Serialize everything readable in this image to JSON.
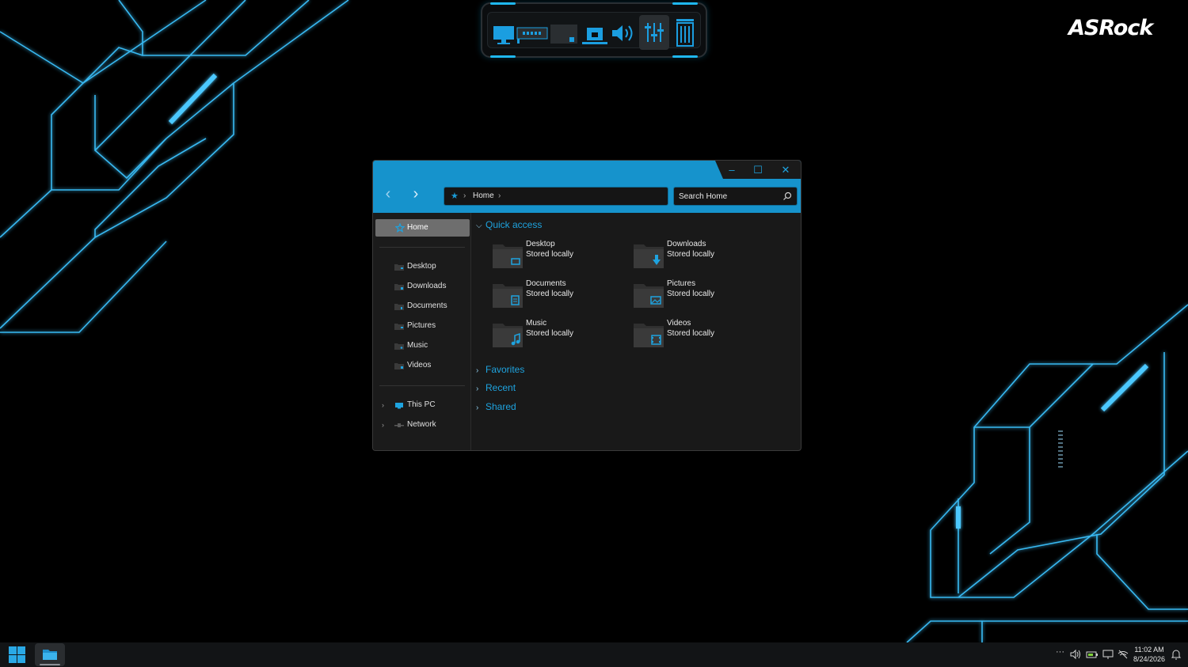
{
  "desktop": {
    "brand_logo": "ASRock",
    "accent_color": "#1ea3df",
    "wallpaper_theme": "black with cyan circuit lines"
  },
  "dock": {
    "items": [
      "monitor-icon",
      "graphics-card-icon",
      "drive-icon",
      "network-icon",
      "speaker-icon",
      "equalizer-icon",
      "recycle-bin-icon"
    ]
  },
  "window": {
    "address": {
      "root_icon": "star-icon",
      "crumb": "Home",
      "separator": "›"
    },
    "search_placeholder": "Search Home",
    "controls": {
      "minimize": "–",
      "maximize": "☐",
      "close": "✕"
    },
    "nav": {
      "back": "‹",
      "forward": "›"
    },
    "sidebar": {
      "home": "Home",
      "libraries": [
        "Desktop",
        "Downloads",
        "Documents",
        "Pictures",
        "Music",
        "Videos"
      ],
      "this_pc": "This PC",
      "network": "Network",
      "expand_glyph": "›"
    },
    "main": {
      "quick_access": "Quick access",
      "groups_collapsed": [
        "Favorites",
        "Recent",
        "Shared"
      ],
      "tiles": [
        {
          "name": "Desktop",
          "sub": "Stored locally",
          "icon": "desktop-icon"
        },
        {
          "name": "Downloads",
          "sub": "Stored locally",
          "icon": "download-arrow-icon"
        },
        {
          "name": "Documents",
          "sub": "Stored locally",
          "icon": "document-icon"
        },
        {
          "name": "Pictures",
          "sub": "Stored locally",
          "icon": "picture-icon"
        },
        {
          "name": "Music",
          "sub": "Stored locally",
          "icon": "music-note-icon"
        },
        {
          "name": "Videos",
          "sub": "Stored locally",
          "icon": "film-icon"
        }
      ]
    }
  },
  "taskbar": {
    "overflow": "···",
    "clock_time": "11:02 AM",
    "clock_date": "8/24/2026",
    "tray_icons": [
      "volume-icon",
      "battery-icon",
      "display-icon",
      "network-off-icon",
      "notification-bell-icon"
    ]
  }
}
